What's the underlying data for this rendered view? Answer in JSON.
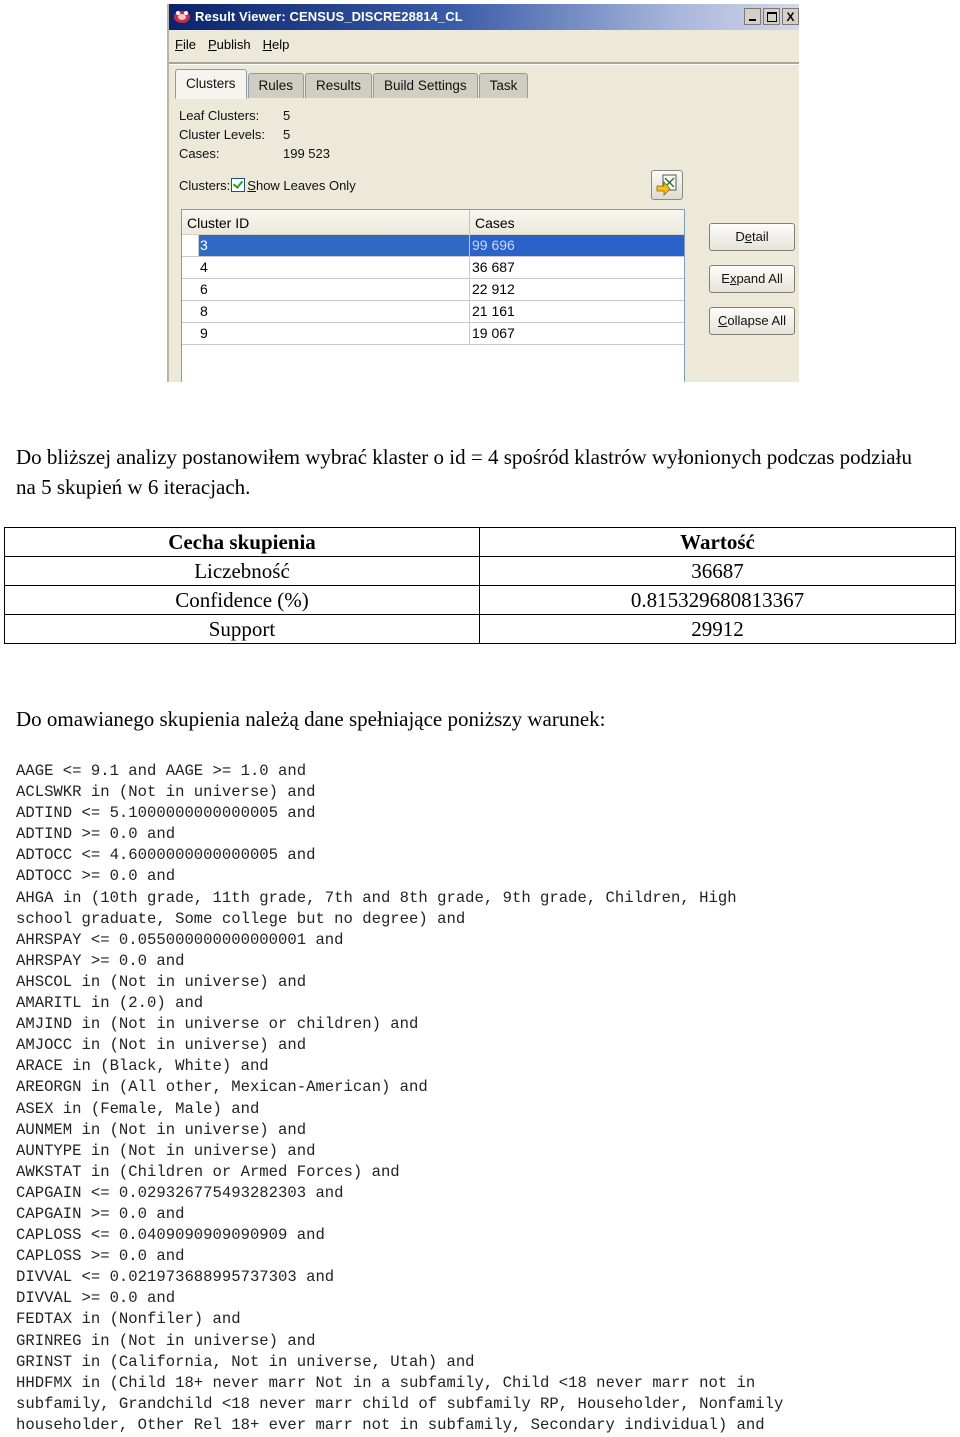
{
  "window": {
    "title": "Result Viewer: CENSUS_DISCRE28814_CL",
    "title_icon": "oracle-miner-icon",
    "controls": {
      "minimize": "_",
      "maximize": "□",
      "close": "X"
    },
    "menu": [
      {
        "label": "File",
        "mnemonic": "F",
        "rest": "ile"
      },
      {
        "label": "Publish",
        "mnemonic": "P",
        "rest": "ublish"
      },
      {
        "label": "Help",
        "mnemonic": "H",
        "rest": "elp"
      }
    ],
    "tabs": [
      {
        "label": "Clusters",
        "active": true
      },
      {
        "label": "Rules",
        "active": false
      },
      {
        "label": "Results",
        "active": false
      },
      {
        "label": "Build Settings",
        "active": false
      },
      {
        "label": "Task",
        "active": false
      }
    ],
    "summary": {
      "leaf_clusters_label": "Leaf Clusters:",
      "leaf_clusters_value": "5",
      "cluster_levels_label": "Cluster Levels:",
      "cluster_levels_value": "5",
      "cases_label": "Cases:",
      "cases_value": "199 523"
    },
    "clusters_filter": {
      "label": "Clusters:",
      "checkbox_label": "Show Leaves Only",
      "checkbox_mnemonic": "S",
      "checkbox_rest": "how Leaves Only",
      "checked": true
    },
    "grid": {
      "columns": [
        "Cluster ID",
        "Cases"
      ],
      "rows": [
        {
          "id": "3",
          "cases": "99 696",
          "selected": true
        },
        {
          "id": "4",
          "cases": "36 687",
          "selected": false
        },
        {
          "id": "6",
          "cases": "22 912",
          "selected": false
        },
        {
          "id": "8",
          "cases": "21 161",
          "selected": false
        },
        {
          "id": "9",
          "cases": "19 067",
          "selected": false
        }
      ]
    },
    "buttons": {
      "detail": {
        "pre": "D",
        "mn": "e",
        "post": "tail"
      },
      "expand_all": {
        "pre": "E",
        "mn": "x",
        "post": "pand All"
      },
      "collapse_all": {
        "pre": "",
        "mn": "C",
        "post": "ollapse All"
      }
    }
  },
  "document": {
    "intro": "Do bliższej analizy postanowiłem wybrać klaster o id = 4 spośród klastrów wyłonionych podczas podziału na 5 skupień w 6 iteracjach.",
    "table": {
      "headers": [
        "Cecha skupienia",
        "Wartość"
      ],
      "rows": [
        [
          "Liczebność",
          "36687"
        ],
        [
          "Confidence (%)",
          "0.815329680813367"
        ],
        [
          "Support",
          "29912"
        ]
      ]
    },
    "condition_intro": "Do omawianego skupienia należą dane spełniające poniższy warunek:",
    "rule_lines": [
      "AAGE <= 9.1 and AAGE >= 1.0 and",
      "ACLSWKR in (Not in universe) and",
      "ADTIND <= 5.1000000000000005 and",
      "ADTIND >= 0.0 and",
      "ADTOCC <= 4.6000000000000005 and",
      "ADTOCC >= 0.0 and",
      "AHGA in (10th grade, 11th grade, 7th and 8th grade, 9th grade, Children, High",
      "school graduate, Some college but no degree) and",
      "AHRSPAY <= 0.055000000000000001 and",
      "AHRSPAY >= 0.0 and",
      "AHSCOL in (Not in universe) and",
      "AMARITL in (2.0) and",
      "AMJIND in (Not in universe or children) and",
      "AMJOCC in (Not in universe) and",
      "ARACE in (Black, White) and",
      "AREORGN in (All other, Mexican-American) and",
      "ASEX in (Female, Male) and",
      "AUNMEM in (Not in universe) and",
      "AUNTYPE in (Not in universe) and",
      "AWKSTAT in (Children or Armed Forces) and",
      "CAPGAIN <= 0.029326775493282303 and",
      "CAPGAIN >= 0.0 and",
      "CAPLOSS <= 0.0409090909090909 and",
      "CAPLOSS >= 0.0 and",
      "DIVVAL <= 0.021973688995737303 and",
      "DIVVAL >= 0.0 and",
      "FEDTAX in (Nonfiler) and",
      "GRINREG in (Not in universe) and",
      "GRINST in (California, Not in universe, Utah) and",
      "HHDFMX in (Child 18+ never marr Not in a subfamily, Child <18 never marr not in",
      "subfamily, Grandchild <18 never marr child of subfamily RP, Householder, Nonfamily",
      "householder, Other Rel 18+ ever marr not in subfamily, Secondary individual) and"
    ]
  }
}
